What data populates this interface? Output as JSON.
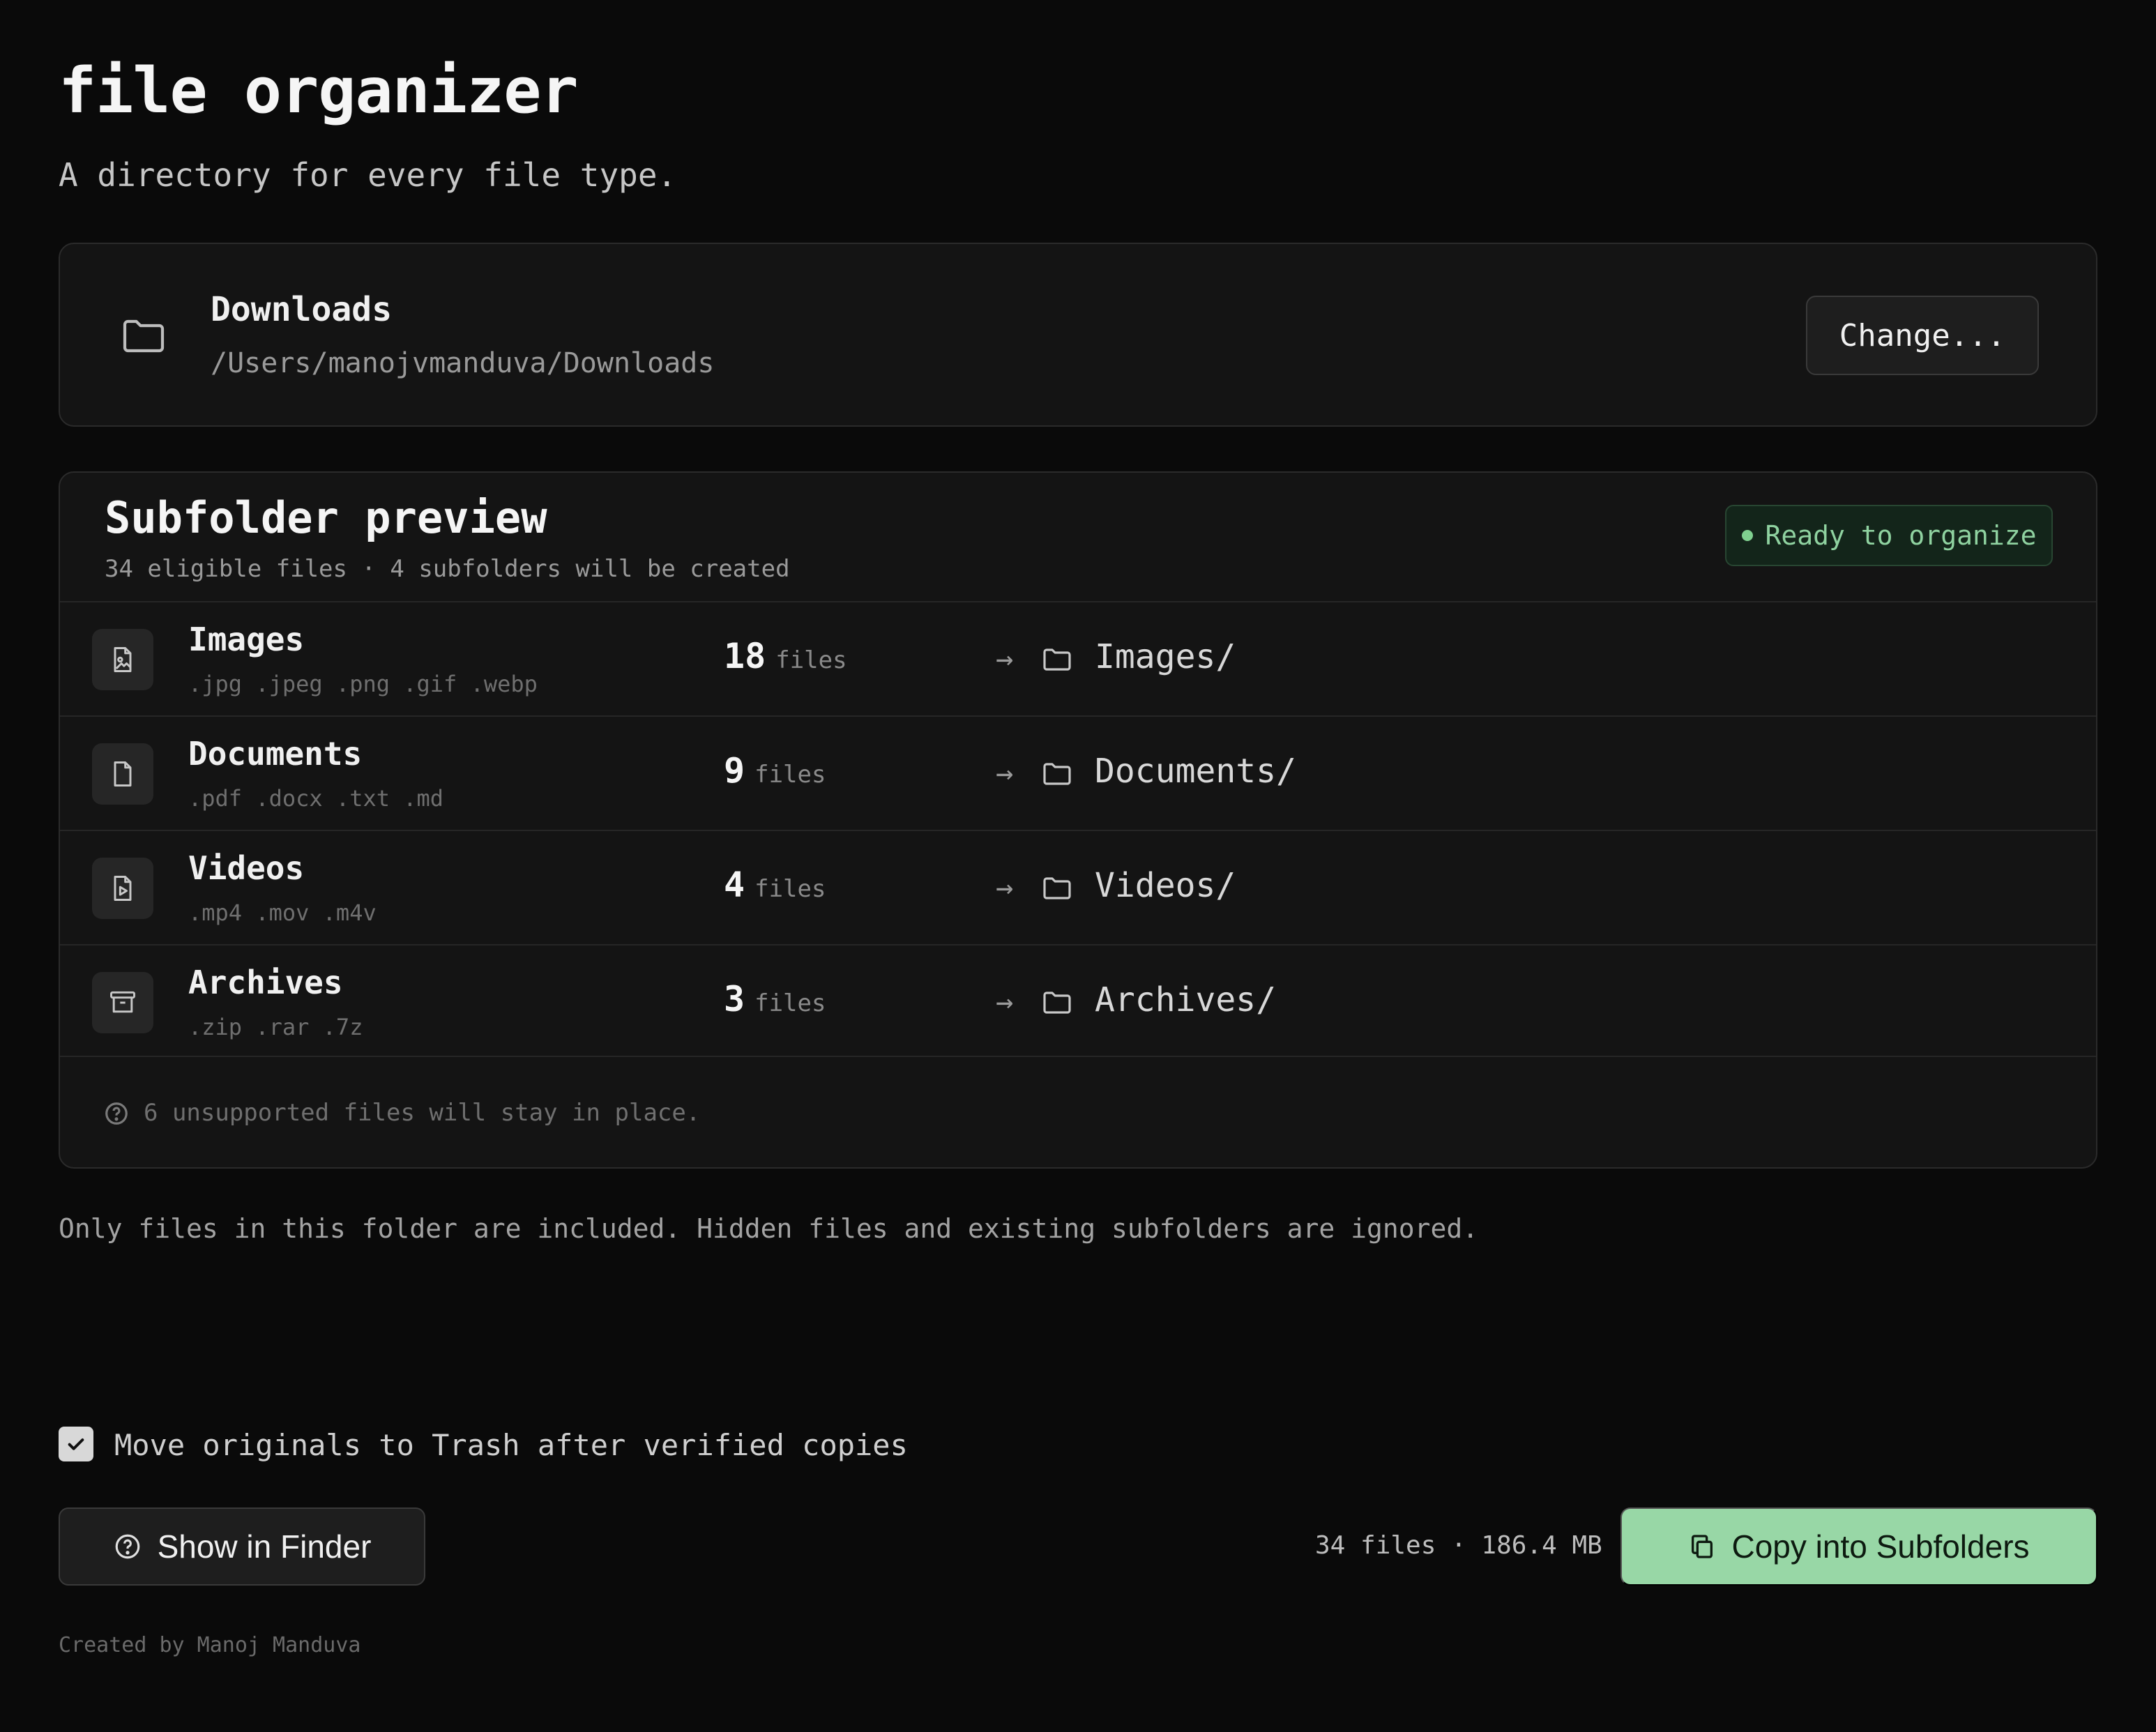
{
  "app": {
    "title": "file organizer",
    "subtitle": "A directory for every file type."
  },
  "folder": {
    "name": "Downloads",
    "path": "/Users/manojvmanduva/Downloads",
    "change_label": "Change...",
    "icon": "folder-icon"
  },
  "preview": {
    "title": "Subfolder preview",
    "summary": "34 eligible files · 4 subfolders will be created",
    "status": "Ready to organize",
    "status_color": "#7fd08f",
    "rows": [
      {
        "name": "Images",
        "extensions": ".jpg .jpeg .png .gif .webp",
        "count": "18",
        "unit": "files",
        "destination": "Images/",
        "icon": "image-file-icon"
      },
      {
        "name": "Documents",
        "extensions": ".pdf .docx .txt .md",
        "count": "9",
        "unit": "files",
        "destination": "Documents/",
        "icon": "document-file-icon"
      },
      {
        "name": "Videos",
        "extensions": ".mp4 .mov .m4v",
        "count": "4",
        "unit": "files",
        "destination": "Videos/",
        "icon": "video-file-icon"
      },
      {
        "name": "Archives",
        "extensions": ".zip .rar .7z",
        "count": "3",
        "unit": "files",
        "destination": "Archives/",
        "icon": "archive-icon"
      }
    ],
    "arrow": "→",
    "unsupported_note": "6 unsupported files will stay in place."
  },
  "info_text": "Only files in this folder are included. Hidden files and existing subfolders are ignored.",
  "options": {
    "trash_label": "Move originals to Trash after verified copies",
    "trash_checked": true
  },
  "actions": {
    "finder_label": "Show in Finder",
    "summary": "34 files · 186.4 MB",
    "copy_label": "Copy into Subfolders",
    "accent": "#98d7a6"
  },
  "footer": {
    "credit": "Created by Manoj Manduva"
  }
}
